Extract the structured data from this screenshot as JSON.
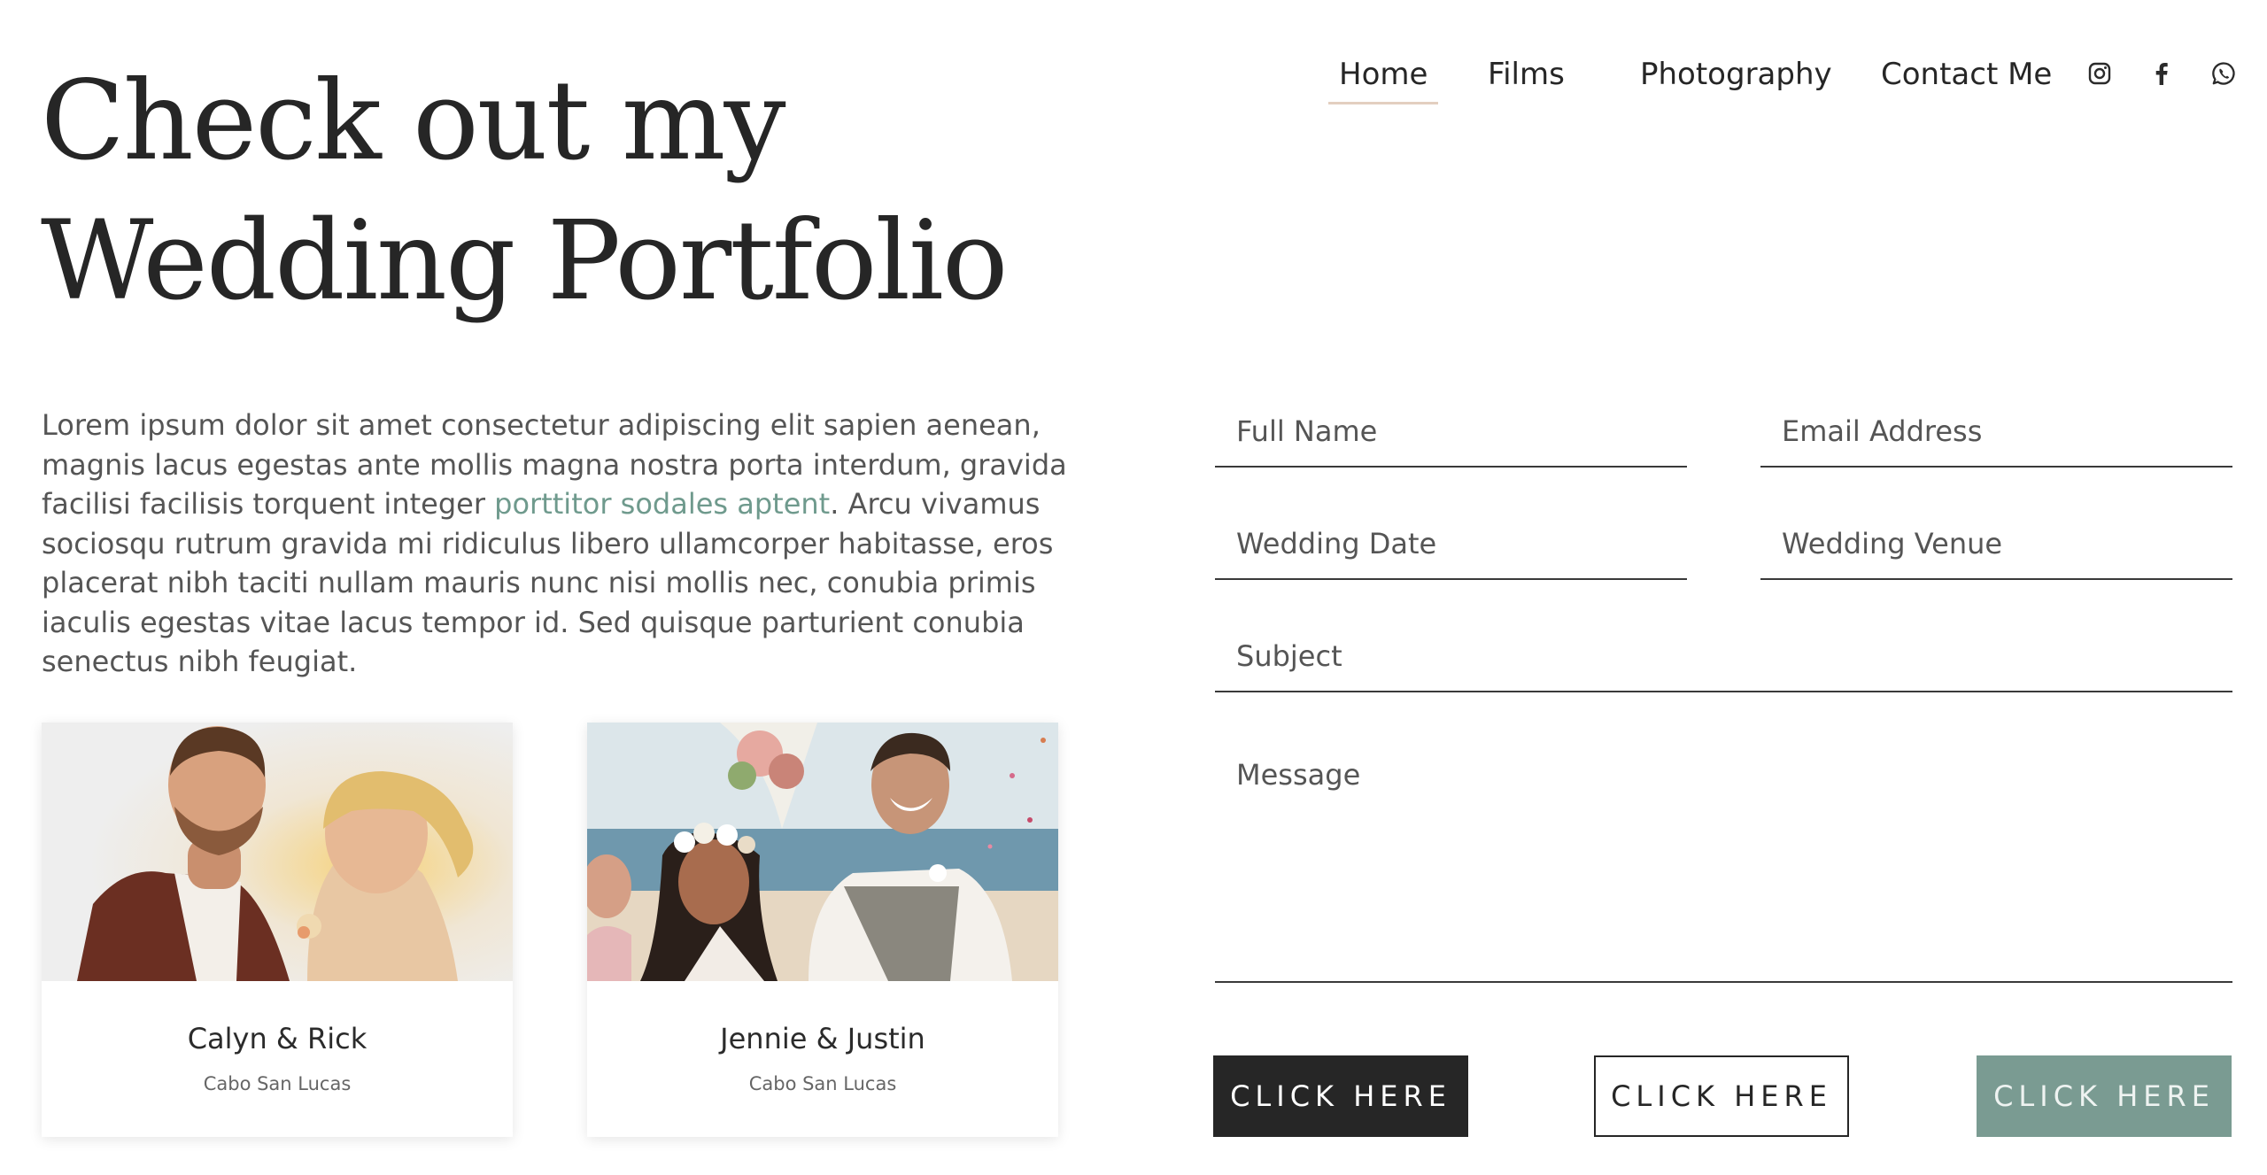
{
  "page": {
    "title_line1": "Check out my",
    "title_line2": "Wedding Portfolio"
  },
  "nav": {
    "items": [
      {
        "label": "Home",
        "active": true
      },
      {
        "label": "Films",
        "active": false
      },
      {
        "label": "Photography",
        "active": false
      },
      {
        "label": "Contact Me",
        "active": false
      }
    ],
    "social": [
      "instagram-icon",
      "facebook-icon",
      "whatsapp-icon"
    ],
    "active_underline_color": "#e3cfc0"
  },
  "intro": {
    "before_link": "Lorem ipsum dolor sit amet consectetur adipiscing elit sapien aenean, magnis lacus egestas ante mollis magna nostra porta interdum, gravida facilisi facilisis torquent integer ",
    "link": "porttitor sodales aptent",
    "after_link": ". Arcu vivamus sociosqu rutrum gravida mi ridiculus libero ullamcorper habitasse, eros placerat nibh taciti nullam mauris nunc nisi mollis nec, conubia primis iaculis egestas vitae lacus tempor id. Sed quisque parturient conubia senectus nibh feugiat.",
    "link_color": "#6f9a8d"
  },
  "portfolio": [
    {
      "names": "Calyn & Rick",
      "place": "Cabo San Lucas"
    },
    {
      "names": "Jennie & Justin",
      "place": "Cabo San Lucas"
    }
  ],
  "form": {
    "full_name": "Full Name",
    "email": "Email Address",
    "wedding_date": "Wedding Date",
    "wedding_venue": "Wedding Venue",
    "subject": "Subject",
    "message": "Message"
  },
  "buttons": [
    {
      "label": "CLICK HERE",
      "style": "dark",
      "color": "#262626"
    },
    {
      "label": "CLICK HERE",
      "style": "outline",
      "color": "#ffffff"
    },
    {
      "label": "CLICK HERE",
      "style": "sage",
      "color": "#7a9b92"
    }
  ]
}
